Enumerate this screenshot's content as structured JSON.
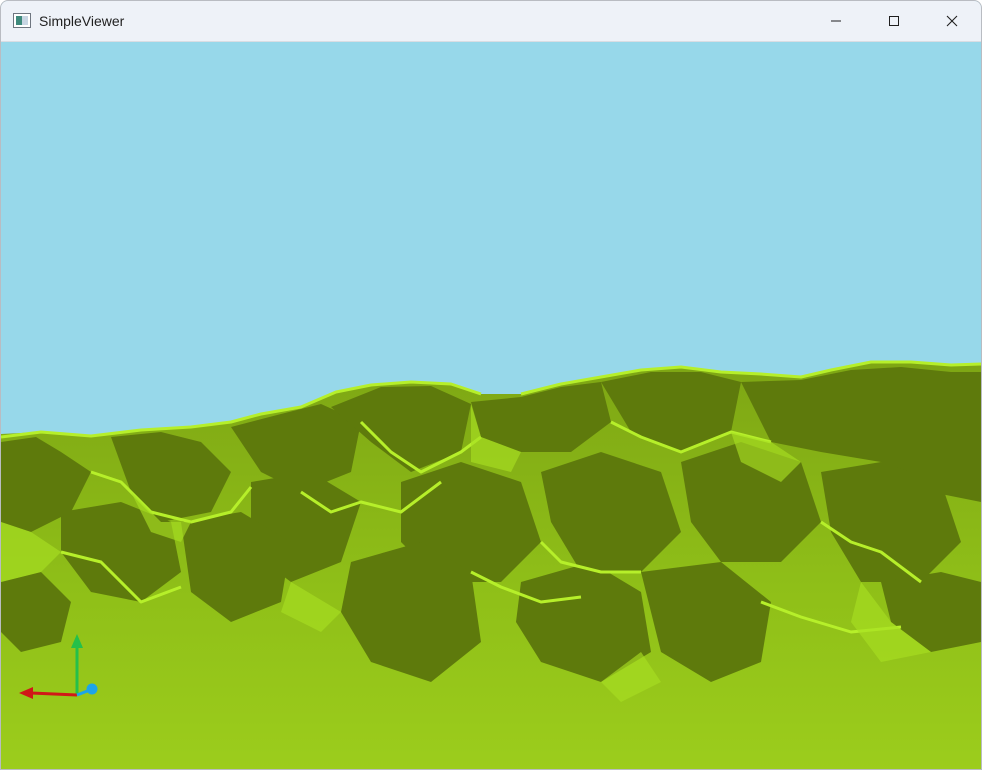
{
  "window": {
    "title": "SimpleViewer",
    "app_icon": "window-app-icon",
    "controls": [
      "minimize-icon",
      "maximize-icon",
      "close-icon"
    ]
  },
  "scene": {
    "sky_color": "#97d8ea",
    "terrain_light": "#9ccd1c",
    "terrain_mid": "#84b316",
    "terrain_shadow": "#5e7a0c",
    "terrain_highlight": "#b6ef2a",
    "axis_x_color": "#d01818",
    "axis_y_color": "#25c04a",
    "axis_z_color": "#1ea4e8"
  }
}
